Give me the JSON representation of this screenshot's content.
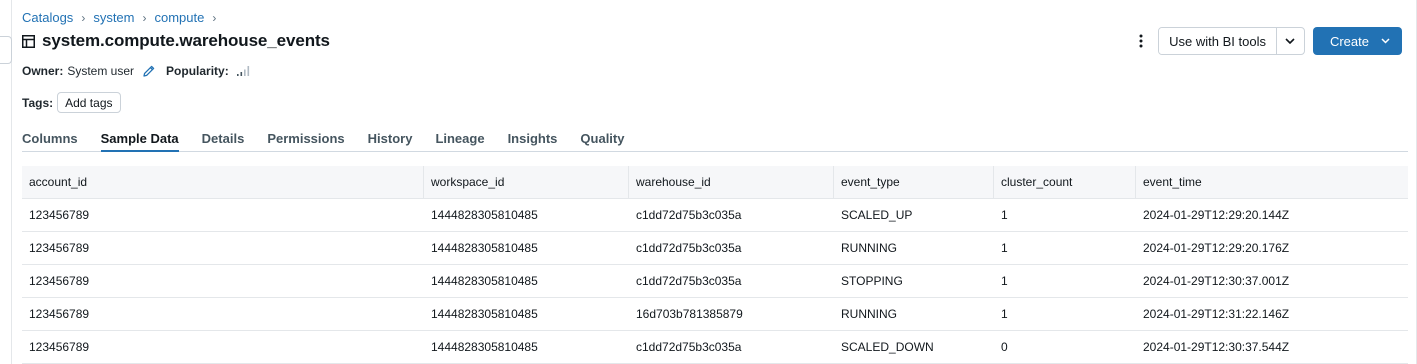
{
  "breadcrumb": [
    "Catalogs",
    "system",
    "compute"
  ],
  "page": {
    "title": "system.compute.warehouse_events"
  },
  "owner": {
    "label": "Owner:",
    "value": "System user"
  },
  "popularity": {
    "label": "Popularity:",
    "level": 2,
    "max": 4
  },
  "tags": {
    "label": "Tags:",
    "add_label": "Add tags"
  },
  "toolbar": {
    "bi_label": "Use with BI tools",
    "create_label": "Create"
  },
  "tabs": [
    "Columns",
    "Sample Data",
    "Details",
    "Permissions",
    "History",
    "Lineage",
    "Insights",
    "Quality"
  ],
  "active_tab": "Sample Data",
  "table": {
    "columns": [
      "account_id",
      "workspace_id",
      "warehouse_id",
      "event_type",
      "cluster_count",
      "event_time"
    ],
    "rows": [
      [
        "123456789",
        "1444828305810485",
        "c1dd72d75b3c035a",
        "SCALED_UP",
        "1",
        "2024-01-29T12:29:20.144Z"
      ],
      [
        "123456789",
        "1444828305810485",
        "c1dd72d75b3c035a",
        "RUNNING",
        "1",
        "2024-01-29T12:29:20.176Z"
      ],
      [
        "123456789",
        "1444828305810485",
        "c1dd72d75b3c035a",
        "STOPPING",
        "1",
        "2024-01-29T12:30:37.001Z"
      ],
      [
        "123456789",
        "1444828305810485",
        "16d703b781385879",
        "RUNNING",
        "1",
        "2024-01-29T12:31:22.146Z"
      ],
      [
        "123456789",
        "1444828305810485",
        "c1dd72d75b3c035a",
        "SCALED_DOWN",
        "0",
        "2024-01-29T12:30:37.544Z"
      ]
    ]
  },
  "colors": {
    "accent": "#2272b4",
    "text": "#11171c",
    "header_bg": "#f6f7f9"
  }
}
